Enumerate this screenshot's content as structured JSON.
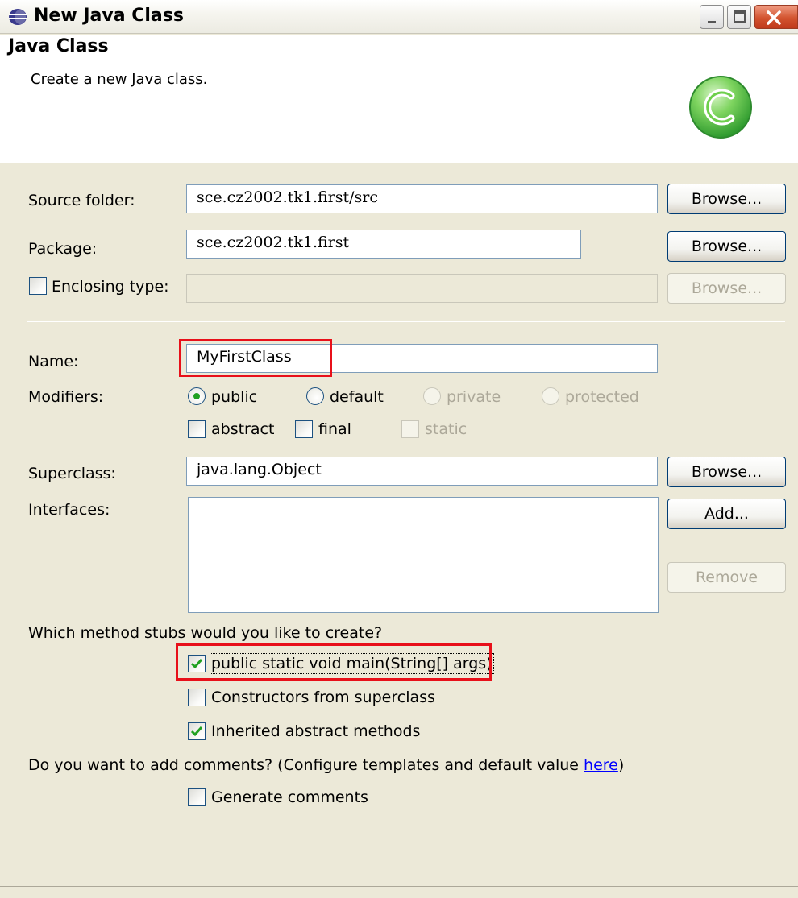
{
  "window": {
    "title": "New Java Class",
    "controls": [
      "minimize-icon",
      "maximize-icon",
      "close-icon"
    ]
  },
  "banner": {
    "title": "Java Class",
    "description": "Create a new Java class.",
    "logo_letter": "C",
    "logo_color": "#3fb43f"
  },
  "form": {
    "source_folder": {
      "label": "Source folder:",
      "value": "sce.cz2002.tk1.first/src",
      "button": "Browse..."
    },
    "package": {
      "label": "Package:",
      "value": "sce.cz2002.tk1.first",
      "button": "Browse..."
    },
    "enclosing_type": {
      "label": "Enclosing type:",
      "checked": false,
      "value": "",
      "button": "Browse...",
      "enabled": false
    },
    "name": {
      "label": "Name:",
      "value": "MyFirstClass",
      "highlighted": true
    },
    "modifiers": {
      "label": "Modifiers:",
      "access": [
        {
          "label": "public",
          "selected": true,
          "enabled": true
        },
        {
          "label": "default",
          "selected": false,
          "enabled": true
        },
        {
          "label": "private",
          "selected": false,
          "enabled": false
        },
        {
          "label": "protected",
          "selected": false,
          "enabled": false
        }
      ],
      "flags": [
        {
          "label": "abstract",
          "checked": false,
          "enabled": true
        },
        {
          "label": "final",
          "checked": false,
          "enabled": true
        },
        {
          "label": "static",
          "checked": false,
          "enabled": false
        }
      ]
    },
    "superclass": {
      "label": "Superclass:",
      "value": "java.lang.Object",
      "button": "Browse..."
    },
    "interfaces": {
      "label": "Interfaces:",
      "add_button": "Add...",
      "remove_button": "Remove",
      "items": []
    },
    "method_stubs": {
      "question": "Which method stubs would you like to create?",
      "options": [
        {
          "label": "public static void main(String[] args)",
          "checked": true,
          "highlighted": true
        },
        {
          "label": "Constructors from superclass",
          "checked": false
        },
        {
          "label": "Inherited abstract methods",
          "checked": true
        }
      ]
    },
    "comments": {
      "question_prefix": "Do you want to add comments? (Configure templates and default value ",
      "link_text": "here",
      "question_suffix": ")",
      "option": {
        "label": "Generate comments",
        "checked": false
      }
    }
  },
  "colors": {
    "highlight": "#e8101a",
    "dialog_bg": "#ece9d8",
    "link": "#0000ff"
  }
}
